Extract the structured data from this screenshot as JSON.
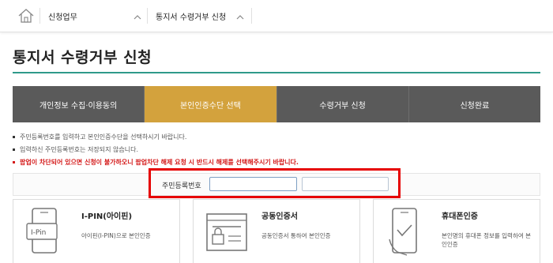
{
  "breadcrumb": {
    "home_icon": "home-icon",
    "items": [
      "신청업무",
      "통지서 수령거부 신청"
    ]
  },
  "page": {
    "title": "통지서 수령거부 신청"
  },
  "steps": [
    {
      "label": "개인정보 수집·이용동의",
      "active": false
    },
    {
      "label": "본인인증수단 선택",
      "active": true
    },
    {
      "label": "수령거부 신청",
      "active": false
    },
    {
      "label": "신청완료",
      "active": false
    }
  ],
  "notes": [
    "주민등록번호를 입력하고 본인인증수단을 선택하시기 바랍니다.",
    "입력하신 주민등록번호는 저장되지 않습니다.",
    "팝업이 차단되어 있으면 신청이 불가하오니 팝업차단 해제 요청 시 반드시 해제를 선택해주시기 바랍니다."
  ],
  "id_field": {
    "label": "주민등록번호",
    "first_value": "",
    "second_value": ""
  },
  "cards": [
    {
      "title": "I-PIN(아이핀)",
      "desc": "아이핀(I-PIN)으로 본인인증",
      "icon": "ipin-phone-icon",
      "icon_text": "I-Pin"
    },
    {
      "title": "공동인증서",
      "desc": "공동인증서 통하여 본인인증",
      "icon": "certificate-icon"
    },
    {
      "title": "휴대폰인증",
      "desc": "본인명의 휴대폰 정보를 입력하여 본인인증",
      "icon": "mobile-check-icon"
    }
  ],
  "colors": {
    "accent": "#d3a23d",
    "step_bg": "#5a5a5a",
    "title_line": "#2f9a8a",
    "warning": "#d41a1a",
    "highlight_border": "#e60000"
  }
}
